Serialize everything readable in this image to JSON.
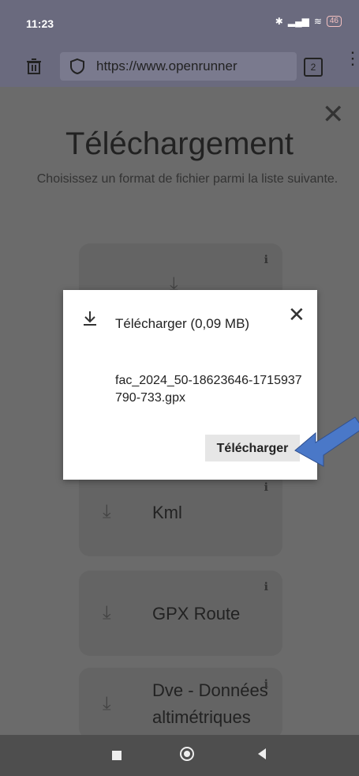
{
  "status_bar": {
    "time": "11:23",
    "battery": "46"
  },
  "browser": {
    "url": "https://www.openrunner",
    "tab_count": "2"
  },
  "page": {
    "title": "Téléchargement",
    "subtitle": "Choisissez un format de fichier parmi la liste suivante.",
    "formats": [
      {
        "label": ""
      },
      {
        "label": "Kml"
      },
      {
        "label": "GPX Route"
      },
      {
        "label": "Dve - Données altimétriques"
      }
    ]
  },
  "dialog": {
    "title": "Télécharger (0,09 MB)",
    "filename": "fac_2024_50-18623646-1715937790-733.gpx",
    "download_button": "Télécharger"
  },
  "colors": {
    "arrow": "#4a78c8",
    "dialog_bg": "#ffffff"
  }
}
